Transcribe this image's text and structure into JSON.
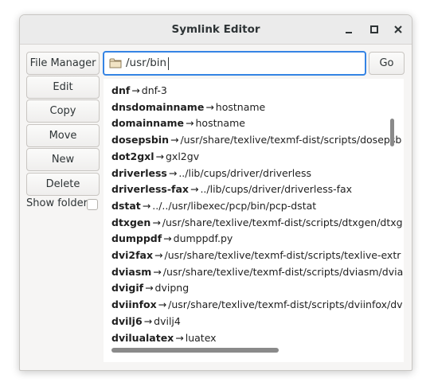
{
  "window": {
    "title": "Symlink Editor",
    "minimize_icon": "minimize-icon",
    "maximize_icon": "maximize-icon",
    "close_icon": "close-icon"
  },
  "toolbar": {
    "file_manager_label": "File Manager",
    "path_value": "/usr/bin",
    "go_label": "Go",
    "folder_icon": "folder-icon"
  },
  "actions": {
    "edit_label": "Edit",
    "copy_label": "Copy",
    "move_label": "Move",
    "new_label": "New",
    "delete_label": "Delete"
  },
  "show_folders": {
    "label": "Show folders",
    "checked": false
  },
  "links": [
    {
      "name": "dnf",
      "target": "dnf-3"
    },
    {
      "name": "dnsdomainname",
      "target": "hostname"
    },
    {
      "name": "domainname",
      "target": "hostname"
    },
    {
      "name": "dosepsbin",
      "target": "/usr/share/texlive/texmf-dist/scripts/dosepsb"
    },
    {
      "name": "dot2gxl",
      "target": "gxl2gv"
    },
    {
      "name": "driverless",
      "target": "../lib/cups/driver/driverless"
    },
    {
      "name": "driverless-fax",
      "target": "../lib/cups/driver/driverless-fax"
    },
    {
      "name": "dstat",
      "target": "../../usr/libexec/pcp/bin/pcp-dstat"
    },
    {
      "name": "dtxgen",
      "target": "/usr/share/texlive/texmf-dist/scripts/dtxgen/dtxg"
    },
    {
      "name": "dumppdf",
      "target": "dumppdf.py"
    },
    {
      "name": "dvi2fax",
      "target": "/usr/share/texlive/texmf-dist/scripts/texlive-extr"
    },
    {
      "name": "dviasm",
      "target": "/usr/share/texlive/texmf-dist/scripts/dviasm/dvia"
    },
    {
      "name": "dvigif",
      "target": "dvipng"
    },
    {
      "name": "dviinfox",
      "target": "/usr/share/texlive/texmf-dist/scripts/dviinfox/dv"
    },
    {
      "name": "dvilj6",
      "target": "dvilj4"
    },
    {
      "name": "dvilualatex",
      "target": "luatex"
    }
  ],
  "arrow_glyph": "→"
}
